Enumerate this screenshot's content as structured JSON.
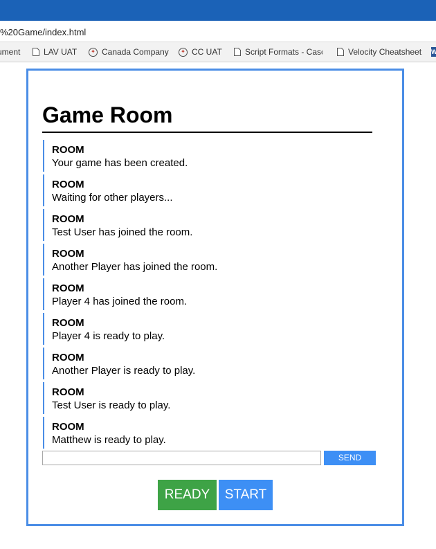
{
  "browser": {
    "address": "%20Game/index.html",
    "bookmarks": [
      {
        "label": "ument",
        "icon": "document-icon"
      },
      {
        "label": "LAV UAT",
        "icon": "document-icon"
      },
      {
        "label": "Canada Company",
        "icon": "maple-leaf-icon"
      },
      {
        "label": "CC UAT",
        "icon": "maple-leaf-icon"
      },
      {
        "label": "Script Formats - Casc",
        "icon": "document-icon"
      },
      {
        "label": "Velocity Cheatsheet",
        "icon": "document-icon"
      }
    ]
  },
  "room": {
    "title": "Game Room",
    "messages": [
      {
        "sender": "ROOM",
        "text": "Your game has been created."
      },
      {
        "sender": "ROOM",
        "text": "Waiting for other players..."
      },
      {
        "sender": "ROOM",
        "text": "Test User has joined the room."
      },
      {
        "sender": "ROOM",
        "text": "Another Player has joined the room."
      },
      {
        "sender": "ROOM",
        "text": "Player 4 has joined the room."
      },
      {
        "sender": "ROOM",
        "text": "Player 4 is ready to play."
      },
      {
        "sender": "ROOM",
        "text": "Another Player is ready to play."
      },
      {
        "sender": "ROOM",
        "text": "Test User is ready to play."
      },
      {
        "sender": "ROOM",
        "text": "Matthew is ready to play."
      }
    ],
    "input_value": "",
    "send_label": "SEND",
    "ready_label": "READY",
    "start_label": "START"
  },
  "colors": {
    "accent": "#4a8de6",
    "ready": "#3ea346",
    "start": "#3d8ff5"
  }
}
